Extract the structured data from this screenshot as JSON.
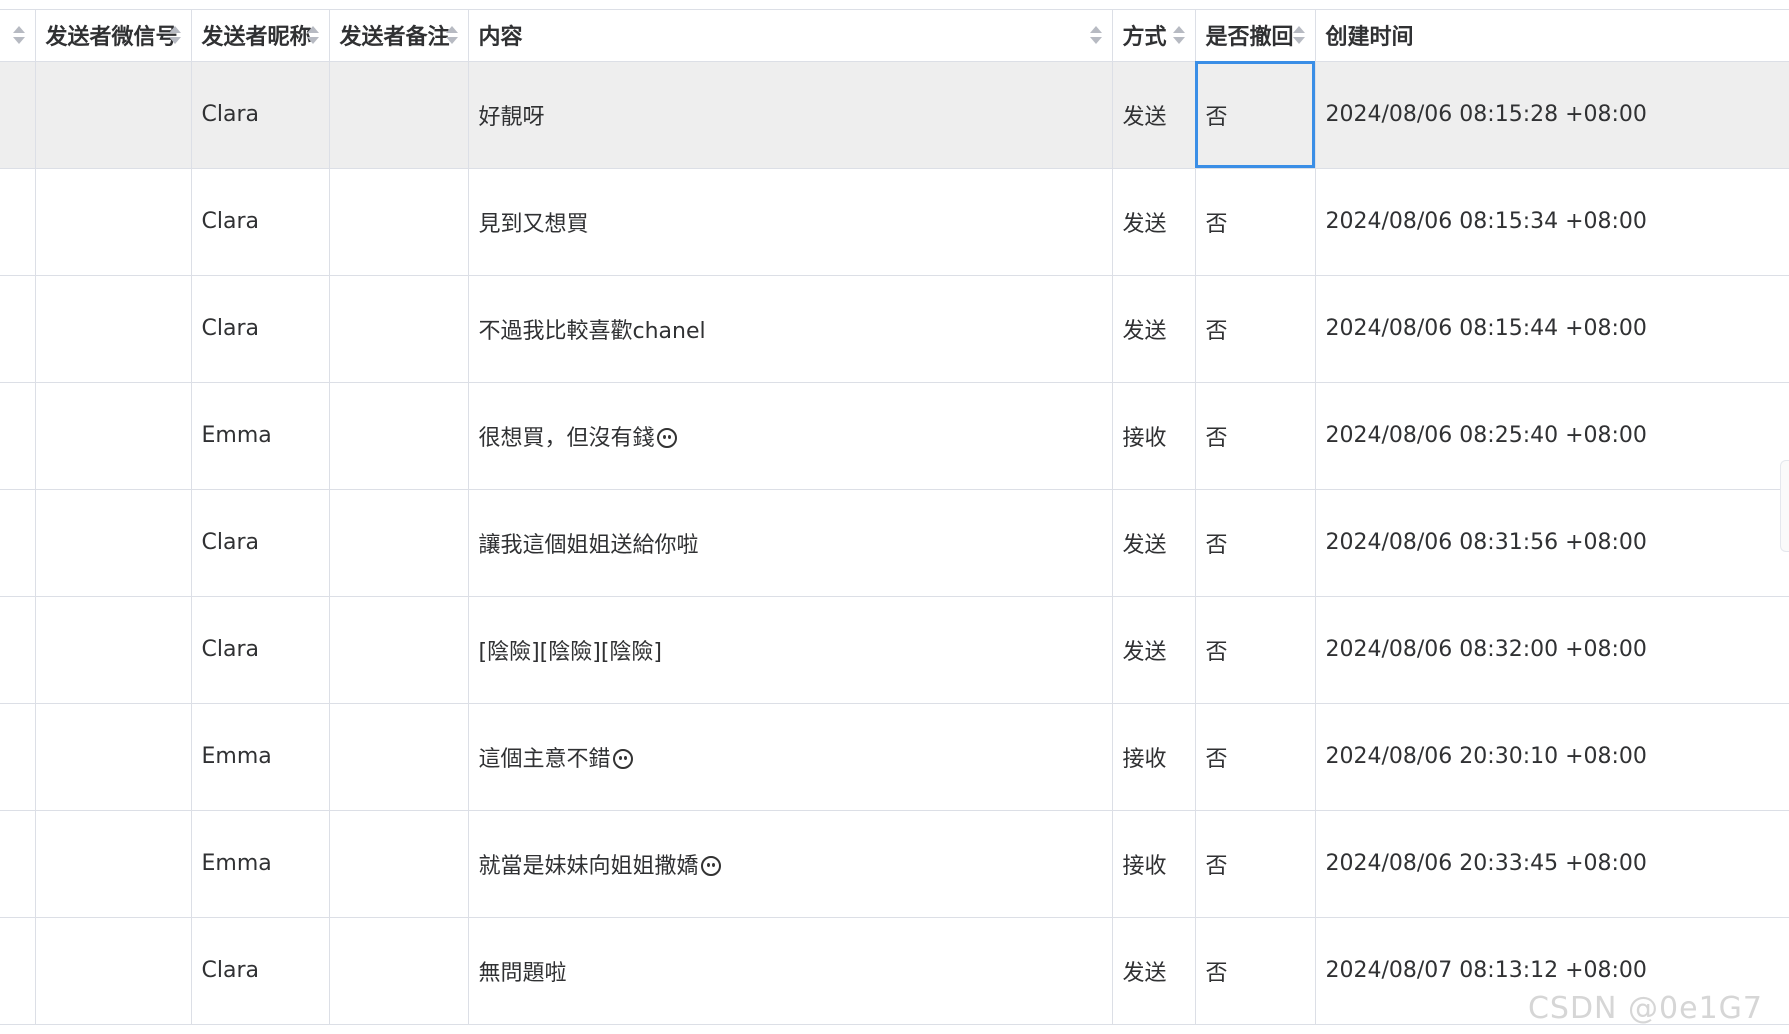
{
  "table": {
    "columns": [
      {
        "key": "id",
        "label": "",
        "sortable": true
      },
      {
        "key": "wxid",
        "label": "发送者微信号",
        "sortable": true
      },
      {
        "key": "nickname",
        "label": "发送者昵称",
        "sortable": true
      },
      {
        "key": "remark",
        "label": "发送者备注",
        "sortable": true
      },
      {
        "key": "content",
        "label": "内容",
        "sortable": true
      },
      {
        "key": "method",
        "label": "方式",
        "sortable": true
      },
      {
        "key": "revoked",
        "label": "是否撤回",
        "sortable": true
      },
      {
        "key": "created",
        "label": "创建时间",
        "sortable": true
      }
    ],
    "rows": [
      {
        "id": "22",
        "wxid": "",
        "nickname": "Clara",
        "remark": "",
        "content": "好靚呀",
        "emoji": "",
        "method": "发送",
        "revoked": "否",
        "created": "2024/08/06 08:15:28 +08:00"
      },
      {
        "id": "22",
        "wxid": "",
        "nickname": "Clara",
        "remark": "",
        "content": "見到又想買",
        "emoji": "",
        "method": "发送",
        "revoked": "否",
        "created": "2024/08/06 08:15:34 +08:00"
      },
      {
        "id": "22",
        "wxid": "",
        "nickname": "Clara",
        "remark": "",
        "content": "不過我比較喜歡chanel",
        "emoji": "",
        "method": "发送",
        "revoked": "否",
        "created": "2024/08/06 08:15:44 +08:00"
      },
      {
        "id": "2",
        "wxid": "",
        "nickname": "Emma",
        "remark": "",
        "content": "很想買，但沒有錢",
        "emoji": "crying-face",
        "method": "接收",
        "revoked": "否",
        "created": "2024/08/06 08:25:40 +08:00"
      },
      {
        "id": "22",
        "wxid": "",
        "nickname": "Clara",
        "remark": "",
        "content": "讓我這個姐姐送給你啦",
        "emoji": "",
        "method": "发送",
        "revoked": "否",
        "created": "2024/08/06 08:31:56 +08:00"
      },
      {
        "id": "22",
        "wxid": "",
        "nickname": "Clara",
        "remark": "",
        "content": "[陰險][陰險][陰險]",
        "emoji": "",
        "method": "发送",
        "revoked": "否",
        "created": "2024/08/06 08:32:00 +08:00"
      },
      {
        "id": "2",
        "wxid": "",
        "nickname": "Emma",
        "remark": "",
        "content": "這個主意不錯",
        "emoji": "smirk-face",
        "method": "接收",
        "revoked": "否",
        "created": "2024/08/06 20:30:10 +08:00"
      },
      {
        "id": "2",
        "wxid": "",
        "nickname": "Emma",
        "remark": "",
        "content": "就當是妹妹向姐姐撒嬌",
        "emoji": "pleading-face",
        "method": "接收",
        "revoked": "否",
        "created": "2024/08/06 20:33:45 +08:00"
      },
      {
        "id": "22",
        "wxid": "",
        "nickname": "Clara",
        "remark": "",
        "content": "無問題啦",
        "emoji": "",
        "method": "发送",
        "revoked": "否",
        "created": "2024/08/07 08:13:12 +08:00"
      }
    ],
    "selected_row": 0,
    "active_cell": {
      "row": 0,
      "column": "revoked"
    }
  },
  "colors": {
    "border": "#dcdfe6",
    "selected_row_bg": "#eeeeee",
    "active_cell_outline": "#3a8ee6",
    "text": "#303133"
  },
  "watermark": "CSDN @0e1G7"
}
